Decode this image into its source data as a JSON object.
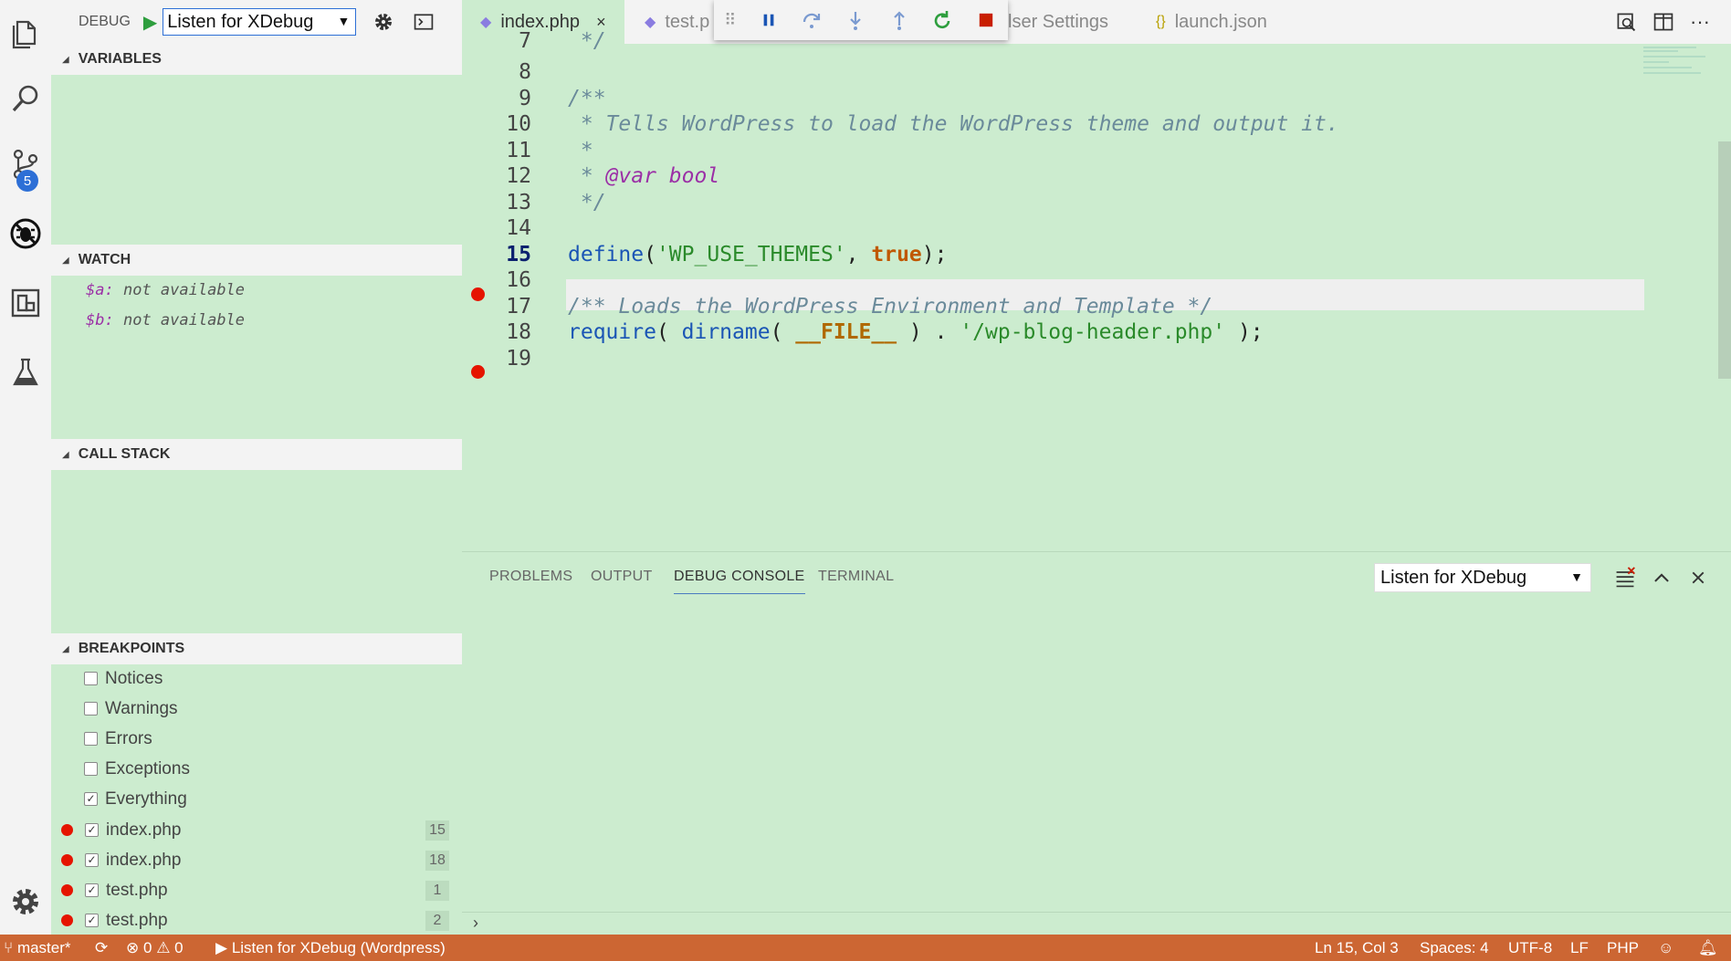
{
  "colors": {
    "background": "#cceccf",
    "status_bar": "#cc6633",
    "accent_blue": "#2d6fd6",
    "breakpoint_red": "#e51400",
    "debug_green": "#2e9e3e"
  },
  "activity_bar": {
    "items": [
      {
        "name": "files-icon"
      },
      {
        "name": "search-icon"
      },
      {
        "name": "source-control-icon",
        "badge": "5"
      },
      {
        "name": "debug-icon"
      },
      {
        "name": "extensions-icon"
      },
      {
        "name": "test-flask-icon"
      }
    ],
    "settings": "gear-icon"
  },
  "debug_toolbar": {
    "label": "DEBUG",
    "configuration": "Listen for XDebug"
  },
  "sections": {
    "variables": "VARIABLES",
    "watch": "WATCH",
    "call_stack": "CALL STACK",
    "breakpoints": "BREAKPOINTS"
  },
  "watch": [
    {
      "var": "$a:",
      "value": "not available"
    },
    {
      "var": "$b:",
      "value": "not available"
    }
  ],
  "breakpoints": {
    "exceptions": [
      {
        "label": "Notices",
        "checked": false
      },
      {
        "label": "Warnings",
        "checked": false
      },
      {
        "label": "Errors",
        "checked": false
      },
      {
        "label": "Exceptions",
        "checked": false
      },
      {
        "label": "Everything",
        "checked": true
      }
    ],
    "files": [
      {
        "file": "index.php",
        "line": "15",
        "checked": true
      },
      {
        "file": "index.php",
        "line": "18",
        "checked": true
      },
      {
        "file": "test.php",
        "line": "1",
        "checked": true
      },
      {
        "file": "test.php",
        "line": "2",
        "checked": true
      }
    ]
  },
  "tabs": [
    {
      "label": "index.php",
      "active": true
    },
    {
      "label": "test.p",
      "active": false
    },
    {
      "label": "lser Settings",
      "active": false
    },
    {
      "label": "launch.json",
      "active": false
    }
  ],
  "tab_close": "×",
  "code": {
    "lines": [
      "7",
      "8",
      "9",
      "10",
      "11",
      "12",
      "13",
      "14",
      "15",
      "16",
      "17",
      "18",
      "19"
    ],
    "current_line": "15",
    "breakpoint_lines": [
      "15",
      "18"
    ],
    "text": {
      "l7": " */",
      "l9": "/**",
      "l10": " * Tells WordPress to load the WordPress theme and output it.",
      "l11": " *",
      "l12_star": " * ",
      "l12_tag": "@var bool",
      "l13": " */",
      "l15_fn": "define",
      "l15_open": "(",
      "l15_str": "'WP_USE_THEMES'",
      "l15_comma": ", ",
      "l15_kw": "true",
      "l15_close": ");",
      "l17": "/** Loads the WordPress Environment and Template */",
      "l18_fn": "require",
      "l18_p1": "( ",
      "l18_fn2": "dirname",
      "l18_p2": "( ",
      "l18_const": "__FILE__",
      "l18_p3": " ) . ",
      "l18_str": "'/wp-blog-header.php'",
      "l18_p4": " );"
    }
  },
  "panel": {
    "tabs": [
      "PROBLEMS",
      "OUTPUT",
      "DEBUG CONSOLE",
      "TERMINAL"
    ],
    "active_tab": "DEBUG CONSOLE",
    "select": "Listen for XDebug",
    "prompt": "›"
  },
  "status_bar": {
    "branch": "master*",
    "errors": "0",
    "warnings": "0",
    "debug_session": "Listen for XDebug (Wordpress)",
    "position": "Ln 15, Col 3",
    "spaces": "Spaces: 4",
    "encoding": "UTF-8",
    "eol": "LF",
    "language": "PHP"
  }
}
